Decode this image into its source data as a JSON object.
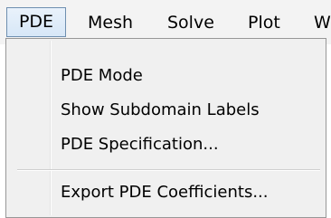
{
  "menubar": {
    "items": [
      {
        "label": "PDE"
      },
      {
        "label": "Mesh"
      },
      {
        "label": "Solve"
      },
      {
        "label": "Plot"
      },
      {
        "label": "W"
      }
    ]
  },
  "dropdown": {
    "items": [
      {
        "label": "PDE Mode"
      },
      {
        "label": "Show Subdomain Labels"
      },
      {
        "label": "PDE Specification..."
      },
      {
        "label": "Export PDE Coefficients..."
      }
    ]
  }
}
